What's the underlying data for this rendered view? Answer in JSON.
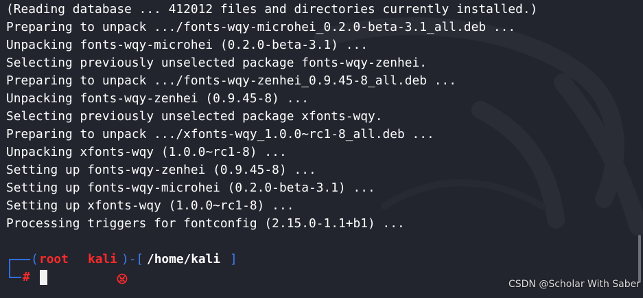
{
  "terminal": {
    "output_lines": [
      "(Reading database ... 412012 files and directories currently installed.)",
      "Preparing to unpack .../fonts-wqy-microhei_0.2.0-beta-3.1_all.deb ...",
      "Unpacking fonts-wqy-microhei (0.2.0-beta-3.1) ...",
      "Selecting previously unselected package fonts-wqy-zenhei.",
      "Preparing to unpack .../fonts-wqy-zenhei_0.9.45-8_all.deb ...",
      "Unpacking fonts-wqy-zenhei (0.9.45-8) ...",
      "Selecting previously unselected package xfonts-wqy.",
      "Preparing to unpack .../xfonts-wqy_1.0.0~rc1-8_all.deb ...",
      "Unpacking xfonts-wqy (1.0.0~rc1-8) ...",
      "Setting up fonts-wqy-zenhei (0.9.45-8) ...",
      "Setting up fonts-wqy-microhei (0.2.0-beta-3.1) ...",
      "Setting up xfonts-wqy (1.0.0~rc1-8) ...",
      "Processing triggers for fontconfig (2.15.0-1.1+b1) ..."
    ],
    "prompt": {
      "open_paren": "(",
      "user": "root",
      "skull_icon": "skull-icon",
      "host": "kali",
      "close_paren_dash": ")-[",
      "path": "/home/kali",
      "close_bracket": "]",
      "symbol": "#"
    },
    "colors": {
      "background": "#23252e",
      "text": "#ffffff",
      "prompt_blue": "#3b7cf5",
      "prompt_red": "#ff2a2a"
    }
  },
  "watermark": {
    "text": "CSDN @Scholar With Saber"
  }
}
